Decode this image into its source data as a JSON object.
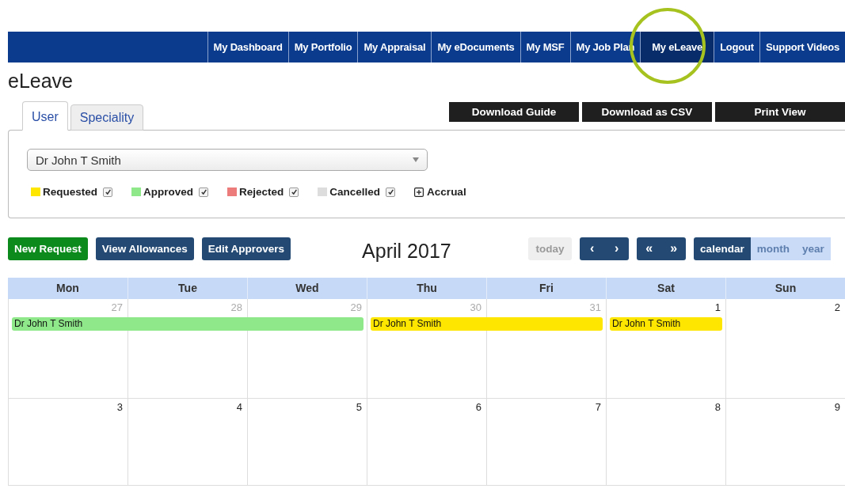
{
  "nav": {
    "items": [
      {
        "label": "My Dashboard",
        "selected": false,
        "circled": false
      },
      {
        "label": "My Portfolio",
        "selected": false,
        "circled": false
      },
      {
        "label": "My Appraisal",
        "selected": false,
        "circled": false
      },
      {
        "label": "My eDocuments",
        "selected": false,
        "circled": false
      },
      {
        "label": "My MSF",
        "selected": false,
        "circled": false
      },
      {
        "label": "My Job Plan",
        "selected": false,
        "circled": false
      },
      {
        "label": "My eLeave",
        "selected": true,
        "circled": true
      },
      {
        "label": "Logout",
        "selected": false,
        "circled": false
      },
      {
        "label": "Support Videos",
        "selected": false,
        "circled": false
      }
    ]
  },
  "page_title": "eLeave",
  "tabs": [
    {
      "label": "User",
      "selected": true
    },
    {
      "label": "Speciality",
      "selected": false
    }
  ],
  "actions": [
    "Download Guide",
    "Download as CSV",
    "Print View"
  ],
  "user_select": {
    "value": "Dr John T Smith"
  },
  "legend": [
    {
      "label": "Requested",
      "color": "#ffe600",
      "checked": true
    },
    {
      "label": "Approved",
      "color": "#8fe88a",
      "checked": true
    },
    {
      "label": "Rejected",
      "color": "#ec7b7b",
      "checked": true
    },
    {
      "label": "Cancelled",
      "color": "#dddddd",
      "checked": true
    }
  ],
  "accrual": {
    "label": "Accrual",
    "expanded": false
  },
  "buttons": [
    {
      "label": "New Request",
      "kind": "primary"
    },
    {
      "label": "View Allowances",
      "kind": "secondary"
    },
    {
      "label": "Edit Approvers",
      "kind": "secondary"
    }
  ],
  "calendar": {
    "title": "April 2017",
    "today": {
      "label": "today",
      "disabled": true
    },
    "prev": "‹",
    "next": "›",
    "prev_year": "«",
    "next_year": "»",
    "views": [
      {
        "label": "calendar",
        "selected": true
      },
      {
        "label": "month",
        "selected": false
      },
      {
        "label": "year",
        "selected": false
      }
    ],
    "days": [
      "Mon",
      "Tue",
      "Wed",
      "Thu",
      "Fri",
      "Sat",
      "Sun"
    ],
    "weeks": [
      {
        "cells": [
          {
            "date": "27",
            "other_month": true,
            "event": {
              "label": "Dr John T Smith",
              "color": "#8fe88a"
            }
          },
          {
            "date": "28",
            "other_month": true,
            "continues": true
          },
          {
            "date": "29",
            "other_month": true,
            "continues": true
          },
          {
            "date": "30",
            "other_month": true,
            "event": {
              "label": "Dr John T Smith",
              "color": "#ffe600"
            }
          },
          {
            "date": "31",
            "other_month": true,
            "continues": true
          },
          {
            "date": "1",
            "other_month": false,
            "event": {
              "label": "Dr John T Smith",
              "color": "#ffe600"
            }
          },
          {
            "date": "2",
            "other_month": false
          }
        ]
      },
      {
        "cells": [
          {
            "date": "3",
            "other_month": false
          },
          {
            "date": "4",
            "other_month": false
          },
          {
            "date": "5",
            "other_month": false
          },
          {
            "date": "6",
            "other_month": false
          },
          {
            "date": "7",
            "other_month": false
          },
          {
            "date": "8",
            "other_month": false
          },
          {
            "date": "9",
            "other_month": false
          }
        ]
      }
    ]
  }
}
